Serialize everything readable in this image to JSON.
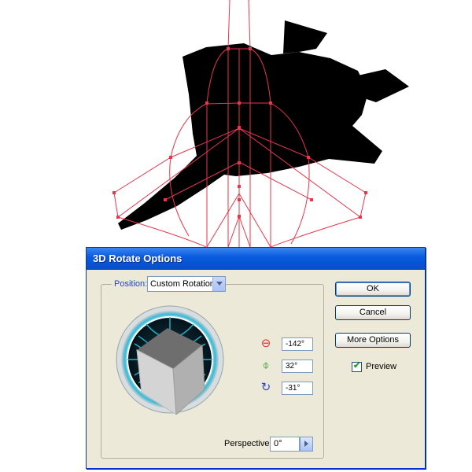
{
  "dialog": {
    "title": "3D Rotate Options",
    "position_label": "Position:",
    "position_value": "Custom Rotation",
    "rotation_x": "-142°",
    "rotation_y": "32°",
    "rotation_z": "-31°",
    "perspective_label": "Perspective:",
    "perspective_value": "0°",
    "buttons": {
      "ok": "OK",
      "cancel": "Cancel",
      "more_options": "More Options"
    },
    "preview_label": "Preview",
    "preview_checked": true
  },
  "icons": {
    "x_axis": "rotate-x-axis-icon",
    "y_axis": "rotate-y-axis-icon",
    "z_axis": "rotate-z-axis-icon"
  },
  "colors": {
    "title_bar": "#0a5ce0",
    "dialog_bg": "#ece9d8",
    "wireframe": "#e8374b",
    "artwork": "#000000",
    "trackball_ring": "#5fd0e6",
    "check": "#21a121"
  }
}
